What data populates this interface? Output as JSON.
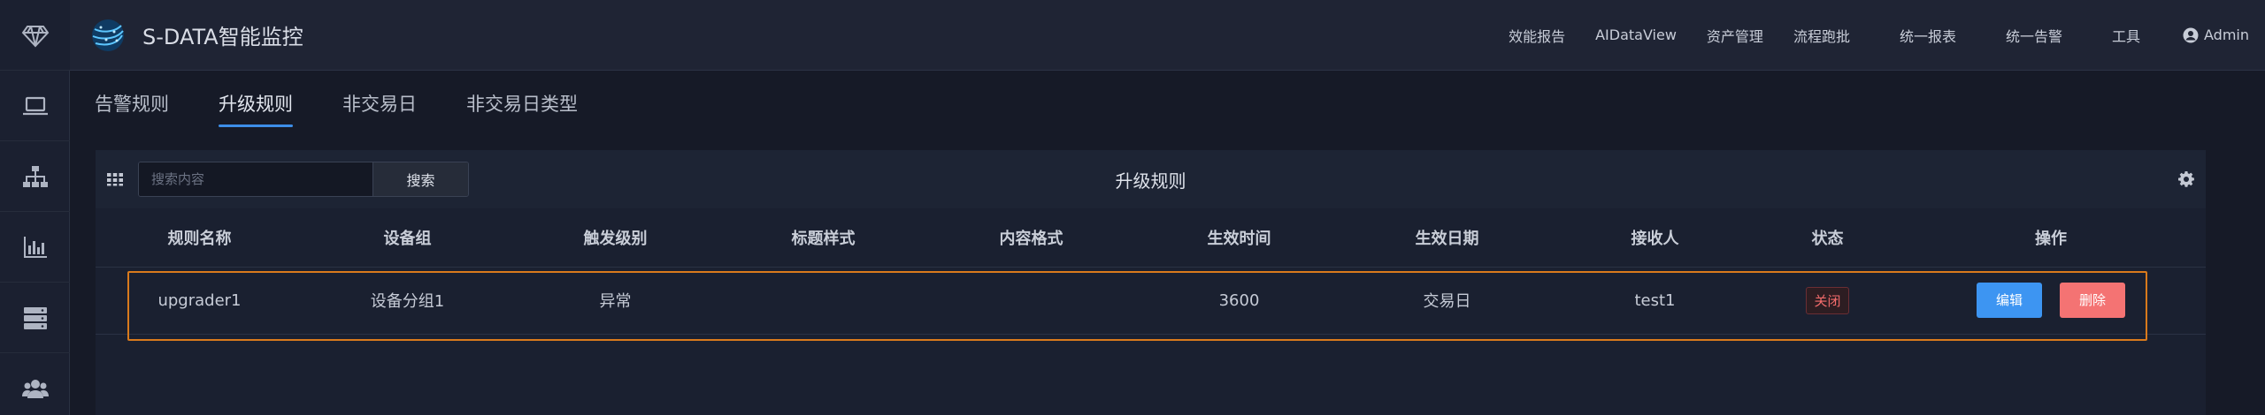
{
  "app": {
    "title": "S-DATA智能监控"
  },
  "nav": {
    "items": [
      "效能报告",
      "AIDataView",
      "资产管理",
      "流程跑批",
      "统一报表",
      "统一告警",
      "工具"
    ],
    "user": "Admin"
  },
  "tabs": [
    "告警规则",
    "升级规则",
    "非交易日",
    "非交易日类型"
  ],
  "active_tab": "升级规则",
  "panel": {
    "title": "升级规则",
    "search_placeholder": "搜索内容",
    "search_button": "搜索"
  },
  "table": {
    "columns": [
      "规则名称",
      "设备组",
      "触发级别",
      "标题样式",
      "内容格式",
      "生效时间",
      "生效日期",
      "接收人",
      "状态",
      "操作"
    ],
    "rows": [
      {
        "name": "upgrader1",
        "group": "设备分组1",
        "level": "异常",
        "title_style": "",
        "content_format": "",
        "effective_time": "3600",
        "effective_date": "交易日",
        "receiver": "test1",
        "status": "关闭",
        "edit": "编辑",
        "delete": "删除"
      }
    ]
  },
  "rail_icons": [
    "diamond-icon",
    "laptop-icon",
    "sitemap-icon",
    "bar-chart-icon",
    "server-icon",
    "users-icon"
  ],
  "colors": {
    "accent": "#3d8ee8",
    "edit": "#3d95f2",
    "delete": "#f47373",
    "highlight": "#d97a1c",
    "status_off": "#f36c6c"
  }
}
